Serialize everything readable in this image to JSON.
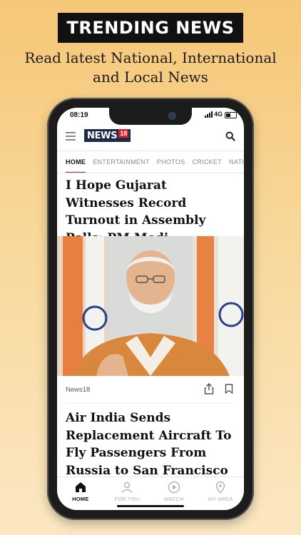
{
  "promo": {
    "badge": "TRENDING NEWS",
    "subtitle_line1": "Read latest National, International",
    "subtitle_line2": "and Local News"
  },
  "status_bar": {
    "time": "08:19",
    "network": "4G"
  },
  "app": {
    "logo_text": "NEWS",
    "logo_number": "18"
  },
  "tabs": [
    "HOME",
    "ENTERTAINMENT",
    "PHOTOS",
    "CRICKET",
    "NATION"
  ],
  "articles": [
    {
      "headline": "I Hope Gujarat Witnesses Record Turnout in Assembly Polls: PM Modi",
      "source": "News18"
    },
    {
      "headline": "Air India Sends Replacement Aircraft To Fly Passengers From Russia to San Francisco"
    }
  ],
  "bottom_nav": [
    "HOME",
    "FOR YOU",
    "WATCH",
    "MY AREA"
  ],
  "colors": {
    "brand_red": "#d81f26",
    "logo_navy": "#1f2a44",
    "badge_black": "#111111"
  },
  "icons": [
    "menu-icon",
    "search-icon",
    "share-icon",
    "bookmark-icon",
    "home-icon",
    "user-icon",
    "play-icon",
    "location-pin-icon"
  ]
}
